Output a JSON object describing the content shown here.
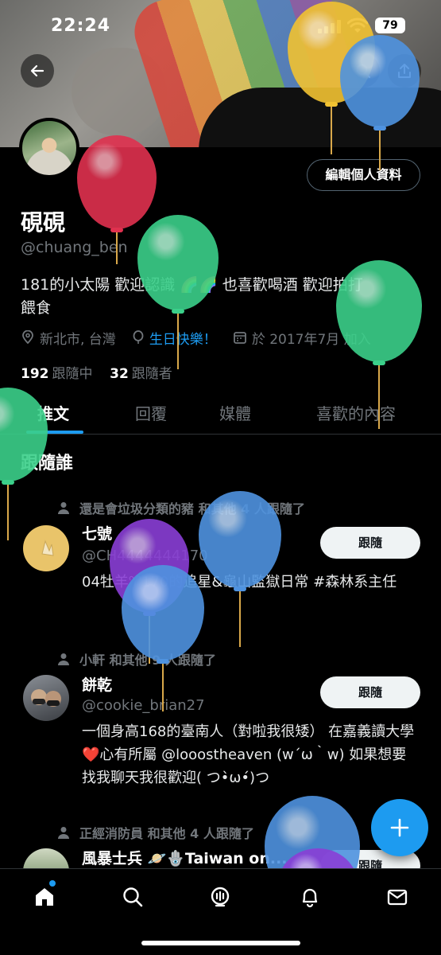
{
  "status_bar": {
    "time": "22:24",
    "battery": "79"
  },
  "profile": {
    "edit_profile_label": "編輯個人資料",
    "display_name": "硯硯",
    "handle": "@chuang_ben",
    "bio_line1": "181的小太陽 歡迎認識 🌈🌈 也喜歡喝酒 歡迎拍打",
    "bio_line2": "餵食",
    "location": "新北市, 台灣",
    "birthday": "生日快樂！",
    "joined": "於 2017年7月 加入",
    "following_count": "192",
    "following_label": "跟隨中",
    "followers_count": "32",
    "followers_label": "跟隨者"
  },
  "tabs": [
    {
      "label": "推文",
      "active": true
    },
    {
      "label": "回覆",
      "active": false
    },
    {
      "label": "媒體",
      "active": false
    },
    {
      "label": "喜歡的內容",
      "active": false
    }
  ],
  "who_to_follow": {
    "title": "跟隨誰",
    "follow_label": "跟隨",
    "users": [
      {
        "context": "還是會垃圾分類的豬 和其他 4 人跟隨了",
        "name": "七號",
        "handle": "@CH4444444170",
        "bio": "04牡羊♈170的追星&龜山監獄日常 #森林系主任"
      },
      {
        "context": "小軒 和其他 9 人跟隨了",
        "name": "餅乾",
        "handle": "@cookie_brian27",
        "bio": "一個身高168的臺南人（對啦我很矮） 在嘉義讀大學 ❤️心有所屬 @looostheaven (w´ω｀w) 如果想要找我聊天我很歡迎( つ•̀ω•́)つ"
      },
      {
        "context": "正經消防員 和其他 4 人跟隨了",
        "name": "風暴士兵 🪐🪬Taiwan on..."
      }
    ]
  },
  "colors": {
    "accent": "#1d9bf0",
    "background": "#000000",
    "secondary_text": "#71767b"
  },
  "icons": [
    "back-arrow-icon",
    "search-icon",
    "share-icon",
    "location-icon",
    "balloon-icon",
    "calendar-icon",
    "person-icon",
    "compose-plus-icon",
    "home-icon",
    "explore-icon",
    "spaces-icon",
    "bell-icon",
    "mail-icon"
  ]
}
